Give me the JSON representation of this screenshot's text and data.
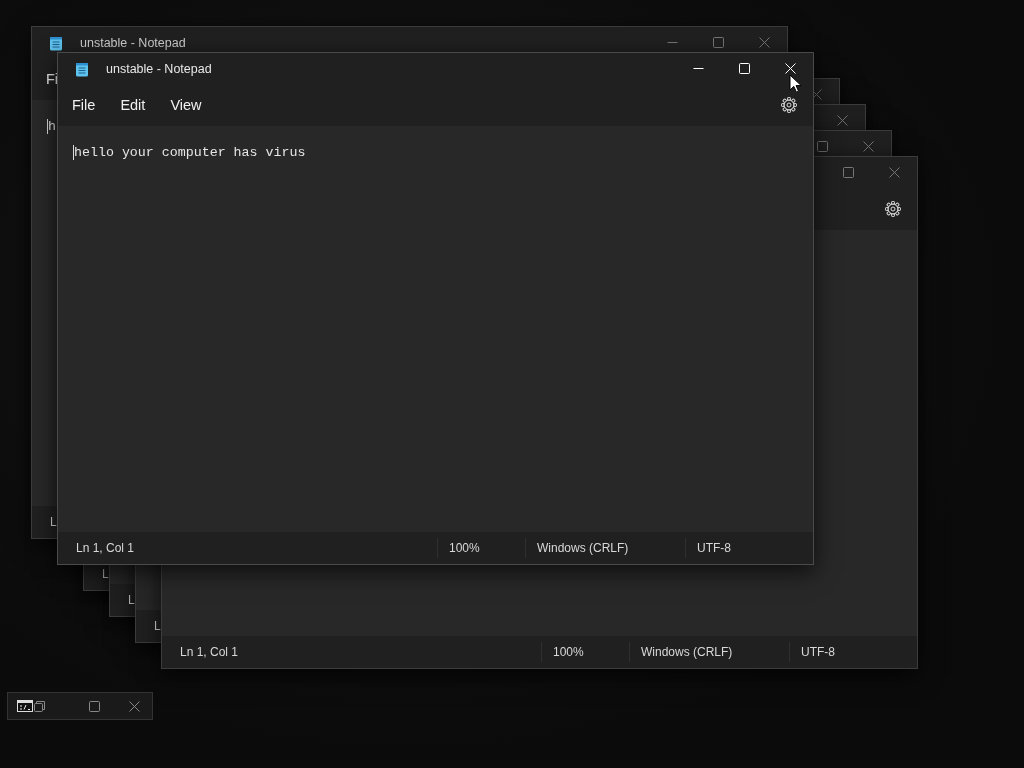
{
  "windows": [
    {
      "active": false,
      "title": "unstable - Notepad",
      "controls": [
        {
          "kind": "minimize"
        },
        {
          "kind": "maximize"
        },
        {
          "kind": "close"
        }
      ],
      "menu": [
        "Fi"
      ],
      "text": "h",
      "status": [
        "L"
      ]
    },
    {
      "active": false,
      "controls": [
        {
          "kind": "close"
        }
      ],
      "status": [
        "L"
      ]
    },
    {
      "active": false,
      "controls": [
        {
          "kind": "close"
        }
      ],
      "status": [
        "L"
      ]
    },
    {
      "active": false,
      "controls": [
        {
          "kind": "maximize"
        },
        {
          "kind": "close"
        }
      ],
      "status": [
        "L"
      ]
    },
    {
      "active": false,
      "controls": [
        {
          "kind": "maximize"
        },
        {
          "kind": "close"
        }
      ],
      "settings": true,
      "status": [
        "Ln 1, Col 1",
        "100%",
        "Windows (CRLF)",
        "UTF-8"
      ]
    },
    {
      "active": true,
      "title": "unstable - Notepad",
      "controls": [
        {
          "kind": "minimize"
        },
        {
          "kind": "maximize"
        },
        {
          "kind": "close"
        }
      ],
      "menu": [
        "File",
        "Edit",
        "View"
      ],
      "settings": true,
      "text": "hello your computer has virus",
      "status": [
        "Ln 1, Col 1",
        "100%",
        "Windows (CRLF)",
        "UTF-8"
      ]
    }
  ],
  "minimized_window": {
    "controls": [
      {
        "kind": "restore"
      },
      {
        "kind": "maximize"
      },
      {
        "kind": "close"
      }
    ]
  }
}
